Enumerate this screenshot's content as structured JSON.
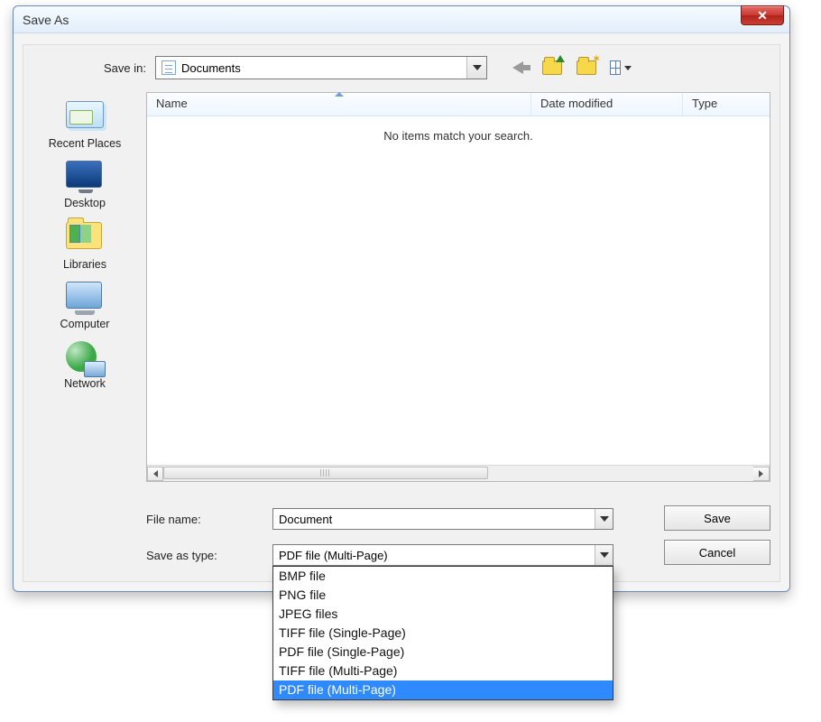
{
  "title": "Save As",
  "savein": {
    "label": "Save in:",
    "value": "Documents"
  },
  "toolbarIcons": [
    "back",
    "folder-up",
    "folder-new",
    "views"
  ],
  "places": [
    {
      "label": "Recent Places"
    },
    {
      "label": "Desktop"
    },
    {
      "label": "Libraries"
    },
    {
      "label": "Computer"
    },
    {
      "label": "Network"
    }
  ],
  "columns": {
    "name": "Name",
    "date": "Date modified",
    "type": "Type"
  },
  "emptyMessage": "No items match your search.",
  "filename": {
    "label": "File name:",
    "value": "Document"
  },
  "filetype": {
    "label": "Save as type:",
    "value": "PDF file (Multi-Page)"
  },
  "buttons": {
    "save": "Save",
    "cancel": "Cancel"
  },
  "typeOptions": [
    "BMP file",
    "PNG file",
    "JPEG files",
    "TIFF file (Single-Page)",
    "PDF file (Single-Page)",
    "TIFF file (Multi-Page)",
    "PDF file (Multi-Page)"
  ],
  "typeSelectedIndex": 6
}
